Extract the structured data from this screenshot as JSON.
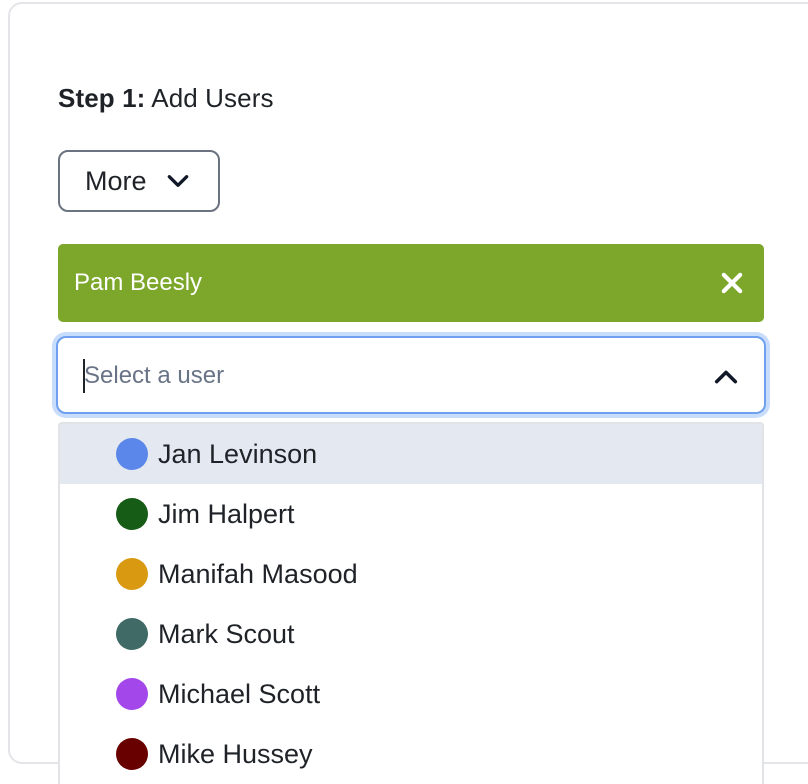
{
  "step": {
    "label": "Step 1:",
    "title": "Add Users"
  },
  "more_button": {
    "label": "More",
    "icon": "chevron-down-icon"
  },
  "selected_chip": {
    "label": "Pam Beesly",
    "close_icon": "close-icon",
    "background_color": "#7ca72b"
  },
  "user_select": {
    "placeholder": "Select a user",
    "value": "",
    "toggle_icon": "chevron-up-icon",
    "focus_color": "#6fa0ef"
  },
  "dropdown": {
    "options": [
      {
        "label": "Jan Levinson",
        "color": "#5b87ea",
        "highlighted": true
      },
      {
        "label": "Jim Halpert",
        "color": "#165b16",
        "highlighted": false
      },
      {
        "label": "Manifah Masood",
        "color": "#d99a12",
        "highlighted": false
      },
      {
        "label": "Mark Scout",
        "color": "#3f6a66",
        "highlighted": false
      },
      {
        "label": "Michael Scott",
        "color": "#a346ea",
        "highlighted": false
      },
      {
        "label": "Mike Hussey",
        "color": "#680000",
        "highlighted": false
      }
    ]
  }
}
